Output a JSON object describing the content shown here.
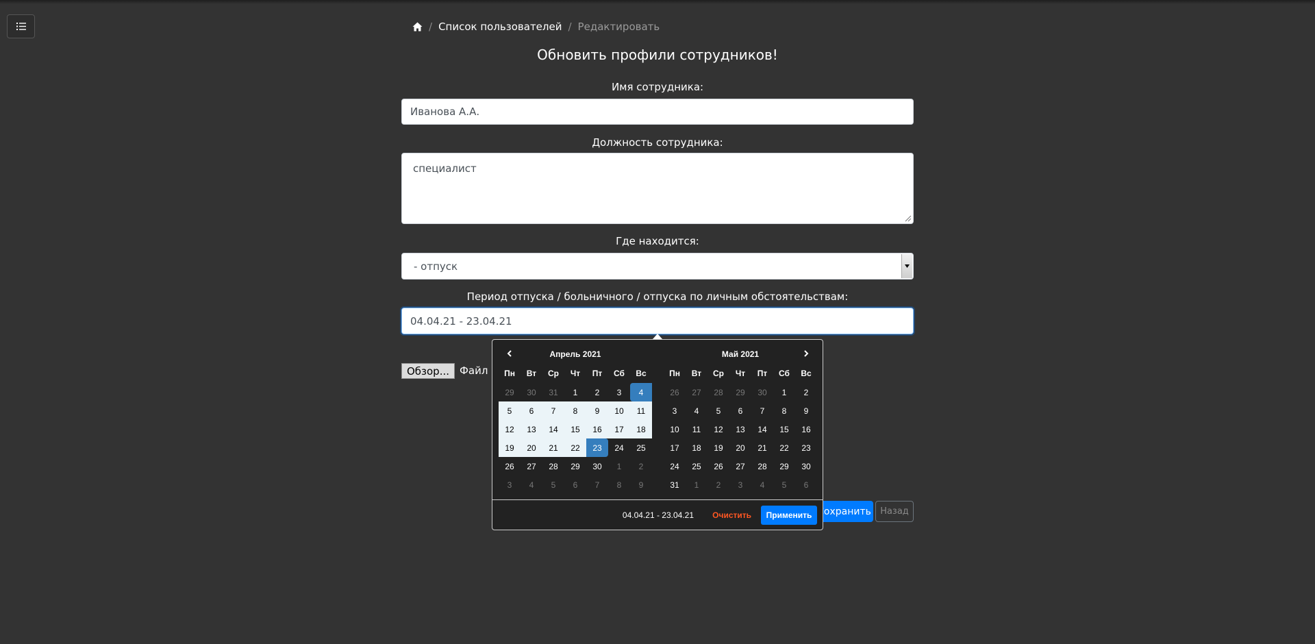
{
  "sidebar_toggle": {
    "icon": "list-icon"
  },
  "breadcrumb": {
    "home_icon": "home-icon",
    "separator": "/",
    "users_list": "Список пользователей",
    "current": "Редактировать"
  },
  "page_title": "Обновить профили сотрудников!",
  "form": {
    "name_label": "Имя сотрудника:",
    "name_value": "Иванова А.А.",
    "position_label": "Должность сотрудника:",
    "position_value": "специалист",
    "location_label": "Где находится:",
    "location_value": "- отпуск",
    "period_label": "Период отпуска / больничного / отпуска по личным обстоятельствам:",
    "period_value": "04.04.21 - 23.04.21",
    "file_button": "Обзор...",
    "file_label": "Файл н",
    "save_button": "Сохранить",
    "back_button": "Назад"
  },
  "datepicker": {
    "weekdays": [
      "Пн",
      "Вт",
      "Ср",
      "Чт",
      "Пт",
      "Сб",
      "Вс"
    ],
    "left": {
      "title": "Апрель 2021",
      "weeks": [
        [
          {
            "d": "29",
            "s": "off"
          },
          {
            "d": "30",
            "s": "off"
          },
          {
            "d": "31",
            "s": "off"
          },
          {
            "d": "1"
          },
          {
            "d": "2"
          },
          {
            "d": "3"
          },
          {
            "d": "4",
            "s": "active start"
          }
        ],
        [
          {
            "d": "5",
            "s": "in-range"
          },
          {
            "d": "6",
            "s": "in-range"
          },
          {
            "d": "7",
            "s": "in-range"
          },
          {
            "d": "8",
            "s": "in-range"
          },
          {
            "d": "9",
            "s": "in-range"
          },
          {
            "d": "10",
            "s": "in-range"
          },
          {
            "d": "11",
            "s": "in-range"
          }
        ],
        [
          {
            "d": "12",
            "s": "in-range"
          },
          {
            "d": "13",
            "s": "in-range"
          },
          {
            "d": "14",
            "s": "in-range"
          },
          {
            "d": "15",
            "s": "in-range"
          },
          {
            "d": "16",
            "s": "in-range"
          },
          {
            "d": "17",
            "s": "in-range"
          },
          {
            "d": "18",
            "s": "in-range"
          }
        ],
        [
          {
            "d": "19",
            "s": "in-range"
          },
          {
            "d": "20",
            "s": "in-range"
          },
          {
            "d": "21",
            "s": "in-range"
          },
          {
            "d": "22",
            "s": "in-range"
          },
          {
            "d": "23",
            "s": "active end"
          },
          {
            "d": "24"
          },
          {
            "d": "25"
          }
        ],
        [
          {
            "d": "26"
          },
          {
            "d": "27"
          },
          {
            "d": "28"
          },
          {
            "d": "29"
          },
          {
            "d": "30"
          },
          {
            "d": "1",
            "s": "off"
          },
          {
            "d": "2",
            "s": "off"
          }
        ],
        [
          {
            "d": "3",
            "s": "off"
          },
          {
            "d": "4",
            "s": "off"
          },
          {
            "d": "5",
            "s": "off"
          },
          {
            "d": "6",
            "s": "off"
          },
          {
            "d": "7",
            "s": "off"
          },
          {
            "d": "8",
            "s": "off"
          },
          {
            "d": "9",
            "s": "off"
          }
        ]
      ]
    },
    "right": {
      "title": "Май 2021",
      "weeks": [
        [
          {
            "d": "26",
            "s": "off"
          },
          {
            "d": "27",
            "s": "off"
          },
          {
            "d": "28",
            "s": "off"
          },
          {
            "d": "29",
            "s": "off"
          },
          {
            "d": "30",
            "s": "off"
          },
          {
            "d": "1"
          },
          {
            "d": "2"
          }
        ],
        [
          {
            "d": "3"
          },
          {
            "d": "4"
          },
          {
            "d": "5"
          },
          {
            "d": "6"
          },
          {
            "d": "7"
          },
          {
            "d": "8"
          },
          {
            "d": "9"
          }
        ],
        [
          {
            "d": "10"
          },
          {
            "d": "11"
          },
          {
            "d": "12"
          },
          {
            "d": "13"
          },
          {
            "d": "14"
          },
          {
            "d": "15"
          },
          {
            "d": "16"
          }
        ],
        [
          {
            "d": "17"
          },
          {
            "d": "18"
          },
          {
            "d": "19"
          },
          {
            "d": "20"
          },
          {
            "d": "21"
          },
          {
            "d": "22"
          },
          {
            "d": "23"
          }
        ],
        [
          {
            "d": "24"
          },
          {
            "d": "25"
          },
          {
            "d": "26"
          },
          {
            "d": "27"
          },
          {
            "d": "28"
          },
          {
            "d": "29"
          },
          {
            "d": "30"
          }
        ],
        [
          {
            "d": "31"
          },
          {
            "d": "1",
            "s": "off"
          },
          {
            "d": "2",
            "s": "off"
          },
          {
            "d": "3",
            "s": "off"
          },
          {
            "d": "4",
            "s": "off"
          },
          {
            "d": "5",
            "s": "off"
          },
          {
            "d": "6",
            "s": "off"
          }
        ]
      ]
    },
    "footer": {
      "selected_range": "04.04.21 - 23.04.21",
      "clear_button": "Очистить",
      "apply_button": "Применить"
    }
  },
  "colors": {
    "background": "#333333",
    "primary": "#007bff",
    "range_active": "#357ebd",
    "range_fill": "#ebf4f8",
    "clear": "#ff5722"
  }
}
